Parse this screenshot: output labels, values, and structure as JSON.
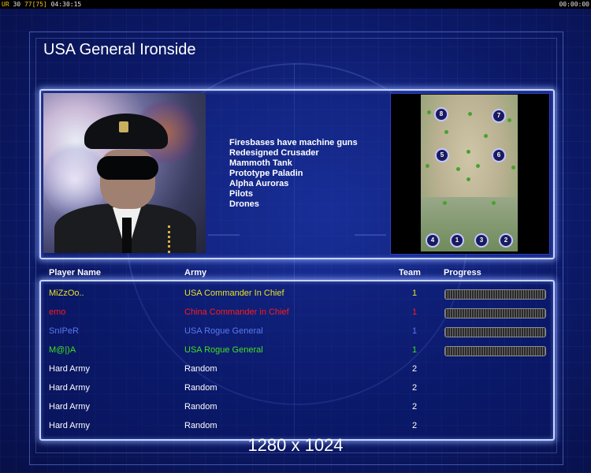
{
  "topbar": {
    "left_prefix": "UR",
    "left_value": "30",
    "left_extra": "77[75]",
    "left_time": "04:30:15",
    "right_time": "00:00:00"
  },
  "general_title": "USA General Ironside",
  "features": [
    "Firesbases have machine guns",
    "Redesigned Crusader",
    "Mammoth Tank",
    "Prototype Paladin",
    "Alpha Auroras",
    "Pilots",
    "Drones"
  ],
  "map": {
    "start_positions": [
      "8",
      "7",
      "5",
      "6",
      "4",
      "1",
      "3",
      "2"
    ]
  },
  "table": {
    "headers": {
      "player": "Player Name",
      "army": "Army",
      "team": "Team",
      "progress": "Progress"
    },
    "rows": [
      {
        "player": "MiZzOo..",
        "army": "USA Commander In Chief",
        "team": "1",
        "color": "#e8e020",
        "has_progress": true
      },
      {
        "player": "emo",
        "army": "China Commander in Chief",
        "team": "1",
        "color": "#ff1a1a",
        "has_progress": true
      },
      {
        "player": "SnIPeR",
        "army": "USA Rogue General",
        "team": "1",
        "color": "#5a78f0",
        "has_progress": true
      },
      {
        "player": "M@|)A",
        "army": "USA Rogue General",
        "team": "1",
        "color": "#40e020",
        "has_progress": true
      },
      {
        "player": "Hard Army",
        "army": "Random",
        "team": "2",
        "color": "#ffffff",
        "has_progress": false
      },
      {
        "player": "Hard Army",
        "army": "Random",
        "team": "2",
        "color": "#ffffff",
        "has_progress": false
      },
      {
        "player": "Hard Army",
        "army": "Random",
        "team": "2",
        "color": "#ffffff",
        "has_progress": false
      },
      {
        "player": "Hard Army",
        "army": "Random",
        "team": "2",
        "color": "#ffffff",
        "has_progress": false
      }
    ]
  },
  "resolution_label": "1280 x 1024"
}
